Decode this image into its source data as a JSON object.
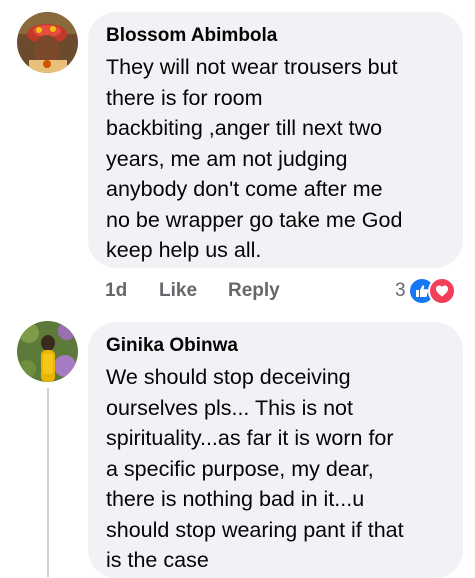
{
  "comments": [
    {
      "author": "Blossom Abimbola",
      "text": "They will not wear trousers but\nthere is for room\nbackbiting ,anger till next two\nyears, me am not judging\nanybody don't come after me\nno be wrapper go take me God\nkeep help us all.",
      "time": "1d",
      "like_label": "Like",
      "reply_label": "Reply",
      "reaction_count": "3",
      "reactions": [
        "like-icon",
        "love-icon"
      ]
    },
    {
      "author": "Ginika Obinwa",
      "text": "We should stop deceiving\nourselves pls... This is not\nspirituality...as far it is worn for\na specific purpose, my dear,\nthere is nothing bad in it...u\nshould stop wearing pant if that\nis the case"
    }
  ],
  "colors": {
    "bubble": "#f0f2f5",
    "secondary_text": "#65676b",
    "like_blue": "#1877f2",
    "love_red": "#f33e58"
  }
}
